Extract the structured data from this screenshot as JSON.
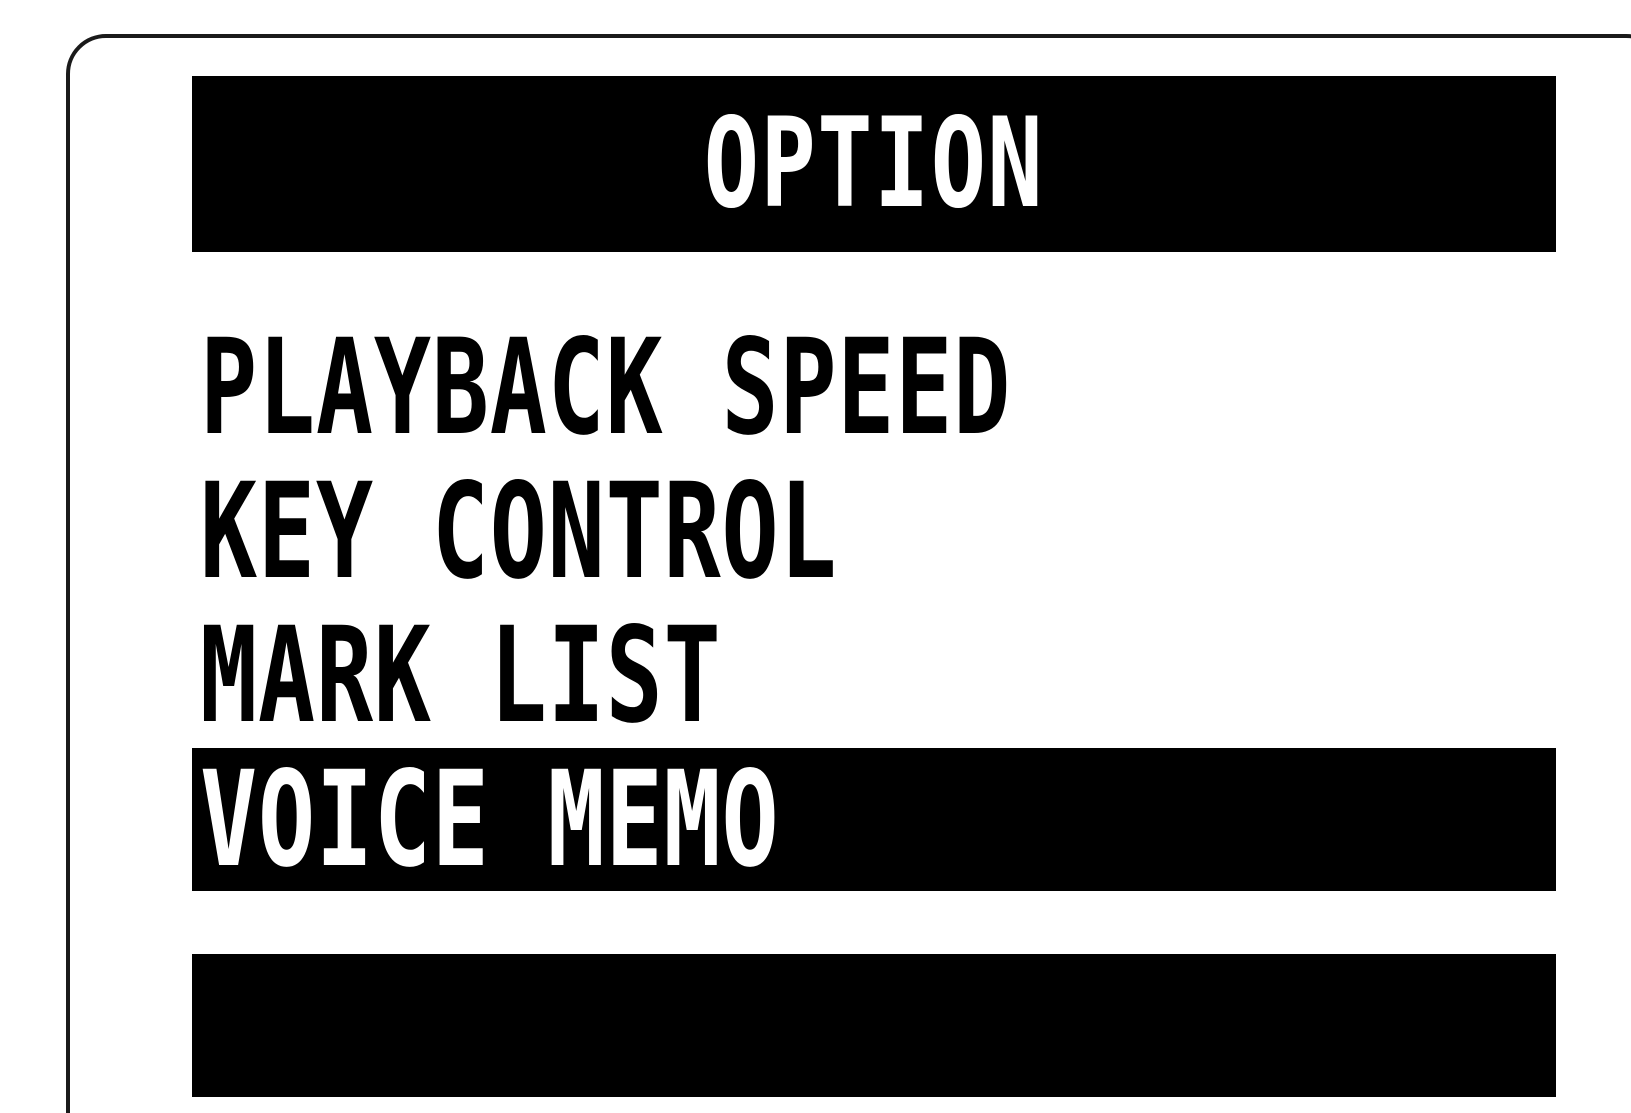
{
  "screen": {
    "title": "OPTION",
    "menu_items": [
      {
        "label": "PLAYBACK SPEED",
        "selected": false
      },
      {
        "label": "KEY CONTROL",
        "selected": false
      },
      {
        "label": "MARK LIST",
        "selected": false
      },
      {
        "label": "VOICE MEMO",
        "selected": true
      }
    ],
    "colors": {
      "background": "#ffffff",
      "foreground": "#000000",
      "highlight": "#000000",
      "highlight_text": "#ffffff"
    }
  }
}
